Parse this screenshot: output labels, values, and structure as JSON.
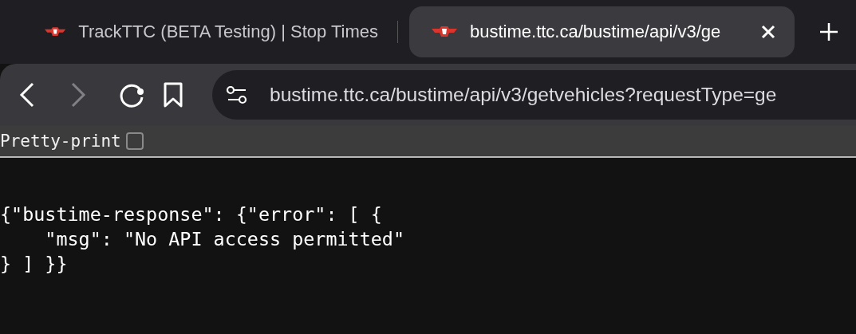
{
  "tabs": [
    {
      "title": "TrackTTC (BETA Testing) | Stop Times",
      "selected": false
    },
    {
      "title": "bustime.ttc.ca/bustime/api/v3/ge",
      "selected": true
    }
  ],
  "toolbar": {
    "forward_disabled": true
  },
  "address_bar": {
    "value": "bustime.ttc.ca/bustime/api/v3/getvehicles?requestType=ge"
  },
  "pretty_print": {
    "label": "Pretty-print",
    "checked": false
  },
  "content_lines": [
    "{\"bustime-response\": {\"error\": [ {",
    "    \"msg\": \"No API access permitted\"",
    "} ] }}"
  ]
}
